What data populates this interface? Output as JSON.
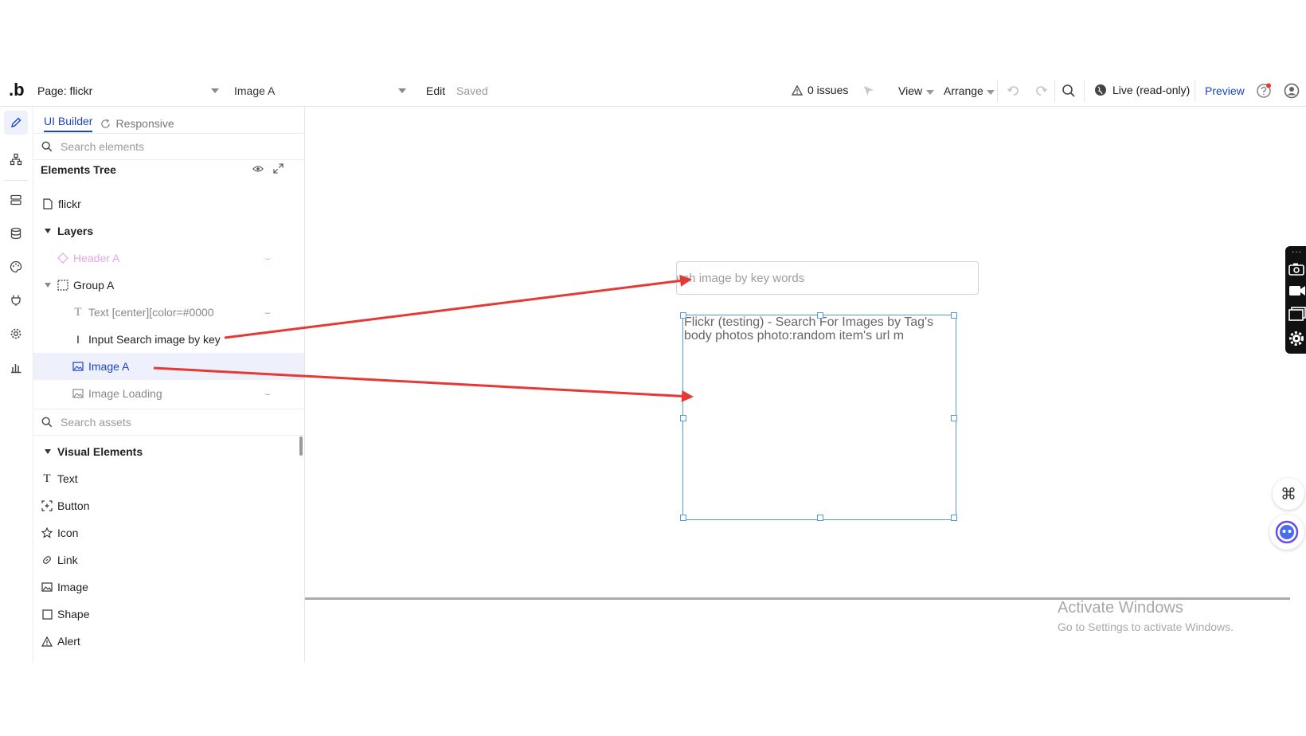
{
  "toolbar": {
    "logo": ".b",
    "page_select": "Page: flickr",
    "element_select": "Image A",
    "edit": "Edit",
    "saved": "Saved",
    "issues": "0 issues",
    "view": "View",
    "arrange": "Arrange",
    "live": "Live (read-only)",
    "preview": "Preview"
  },
  "panel": {
    "tabs": {
      "ui_builder": "UI Builder",
      "responsive": "Responsive"
    },
    "search_elements_placeholder": "Search elements",
    "elements_tree_title": "Elements Tree",
    "tree": {
      "page": "flickr",
      "layers": "Layers",
      "header": "Header A",
      "group": "Group A",
      "text_item": "Text [center][color=#0000",
      "input_item": "Input Search image by key",
      "image_a": "Image A",
      "image_loading": "Image Loading"
    },
    "search_assets_placeholder": "Search assets",
    "visual_elements_title": "Visual Elements",
    "visual_elements": {
      "text": "Text",
      "button": "Button",
      "icon": "Icon",
      "link": "Link",
      "image": "Image",
      "shape": "Shape",
      "alert": "Alert"
    }
  },
  "canvas": {
    "search_placeholder": "earch image  by key words",
    "image_text_line1": "Flickr (testing) - Search For Images by Tag's",
    "image_text_line2": "body photos photo:random item's url  m"
  },
  "watermark": {
    "title": "Activate Windows",
    "subtitle": "Go to Settings to activate Windows."
  },
  "colors": {
    "accent": "#1a44c8",
    "selection": "#5b9bd5",
    "arrow": "#e53935"
  }
}
